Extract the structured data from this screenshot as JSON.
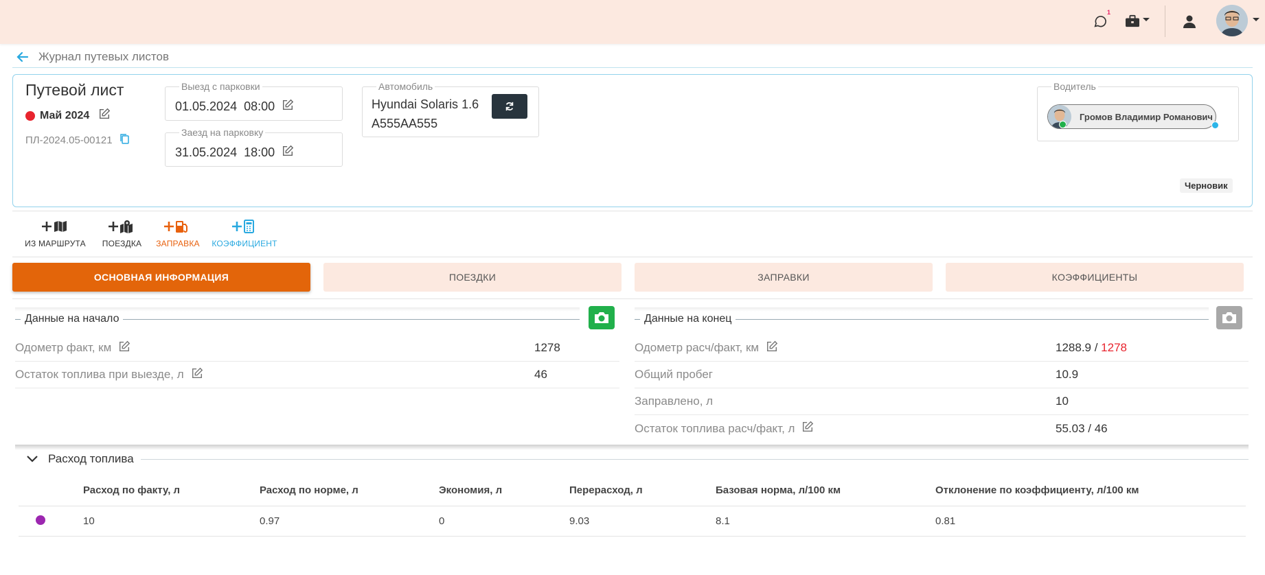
{
  "topbar": {
    "chat_badge": "1",
    "icons": [
      "chat-icon",
      "briefcase-icon",
      "user-icon",
      "avatar"
    ]
  },
  "breadcrumb": {
    "back_icon": "arrow-left-icon",
    "label": "Журнал путевых листов"
  },
  "waybill": {
    "title": "Путевой лист",
    "month": "Май 2024",
    "month_status_color": "#e8242e",
    "number": "ПЛ-2024.05-00121",
    "departure": {
      "legend": "Выезд с парковки",
      "date": "01.05.2024",
      "time": "08:00"
    },
    "arrival": {
      "legend": "Заезд на парковку",
      "date": "31.05.2024",
      "time": "18:00"
    },
    "vehicle": {
      "legend": "Автомобиль",
      "model": "Hyundai Solaris 1.6",
      "plate": "A555AA555"
    },
    "driver": {
      "legend": "Водитель",
      "name": "Громов Владимир Романович"
    },
    "status": "Черновик"
  },
  "actions": [
    {
      "label": "ИЗ МАРШРУТА",
      "icon": "plus-map-icon",
      "color": "#333333"
    },
    {
      "label": "ПОЕЗДКА",
      "icon": "plus-map-marker-icon",
      "color": "#333333"
    },
    {
      "label": "ЗАПРАВКА",
      "icon": "plus-fuel-pump-icon",
      "color": "#e8610e"
    },
    {
      "label": "КОЭФФИЦИЕНТ",
      "icon": "plus-calculator-icon",
      "color": "#29a9e0"
    }
  ],
  "tabs": [
    {
      "label": "ОСНОВНАЯ ИНФОРМАЦИЯ",
      "active": true
    },
    {
      "label": "ПОЕЗДКИ",
      "active": false
    },
    {
      "label": "ЗАПРАВКИ",
      "active": false
    },
    {
      "label": "КОЭФФИЦИЕНТЫ",
      "active": false
    }
  ],
  "start_data": {
    "title": "Данные на начало",
    "camera_color": "#21b04b",
    "rows": [
      {
        "label": "Одометр факт, км",
        "value": "1278",
        "editable": true
      },
      {
        "label": "Остаток топлива при выезде, л",
        "value": "46",
        "editable": true
      }
    ]
  },
  "end_data": {
    "title": "Данные на конец",
    "camera_color": "#a8a8a8",
    "rows": [
      {
        "label": "Одометр расч/факт, км",
        "value": "1288.9 / ",
        "value_alert": "1278",
        "editable": true
      },
      {
        "label": "Общий пробег",
        "value": "10.9",
        "editable": false
      },
      {
        "label": "Заправлено, л",
        "value": "10",
        "editable": false
      },
      {
        "label": "Остаток топлива расч/факт, л",
        "value": "55.03 / 46",
        "editable": true
      }
    ]
  },
  "fuel": {
    "title": "Расход топлива",
    "columns": [
      "Расход по факту, л",
      "Расход по норме, л",
      "Экономия, л",
      "Перерасход, л",
      "Базовая норма, л/100 км",
      "Отклонение по коэффициенту, л/100 км"
    ],
    "rows": [
      {
        "marker_color": "#9c27b0",
        "cells": [
          "10",
          "0.97",
          "0",
          "9.03",
          "8.1",
          "0.81"
        ]
      }
    ]
  }
}
